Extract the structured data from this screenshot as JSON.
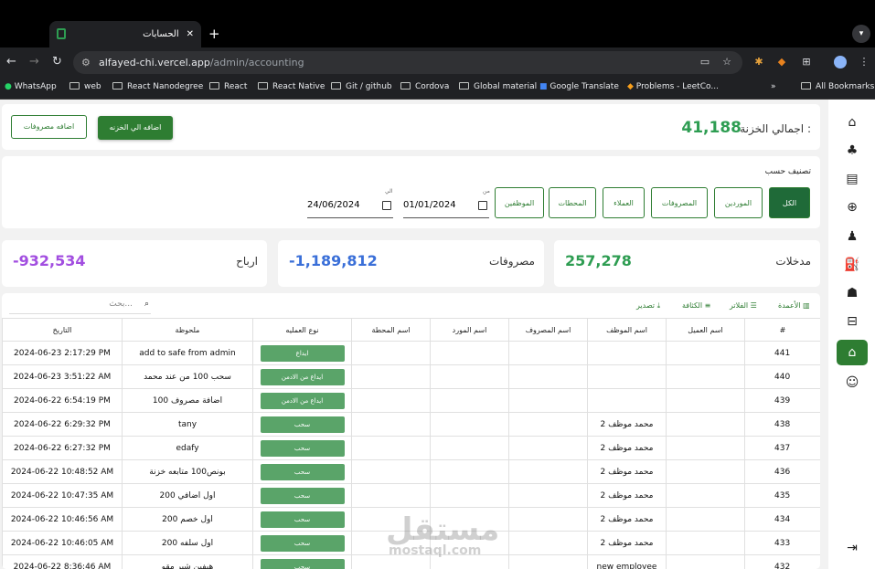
{
  "browser": {
    "tab_title": "الحسابات",
    "url_host": "alfayed-chi.vercel.app",
    "url_path": "/admin/accounting",
    "bookmarks": [
      "WhatsApp",
      "web",
      "React Nanodegree",
      "React",
      "React Native",
      "Git / github",
      "Cordova",
      "Global material",
      "Google Translate",
      "Problems - LeetCo...",
      "All Bookmarks"
    ]
  },
  "header": {
    "total_label": "اجمالي الخزنة :",
    "total_value": "41,188",
    "add_safe_button": "اضافه الي الخزنه",
    "add_expense_button": "اضافه مصروفات"
  },
  "filter": {
    "title": "تصنيف حسب",
    "buttons": [
      "الكل",
      "الموردين",
      "المصروفات",
      "العملاء",
      "المحطات",
      "الموظفين"
    ],
    "from_label": "من",
    "to_label": "الي",
    "from_date": "01/01/2024",
    "to_date": "24/06/2024"
  },
  "stats": {
    "income_label": "مدخلات",
    "income_value": "257,278",
    "expenses_label": "مصروفات",
    "expenses_value": "-1,189,812",
    "profit_label": "ارباح",
    "profit_value": "-932,534"
  },
  "toolbar": {
    "columns": "الأعمدة",
    "filters": "الفلاتر",
    "density": "الكثافة",
    "export": "تصدير",
    "search_placeholder": "بحث..."
  },
  "table": {
    "headers": [
      "#",
      "اسم العميل",
      "اسم الموظف",
      "اسم المصروف",
      "اسم المورد",
      "اسم المحطة",
      "نوع العمليه",
      "ملحوظة",
      "التاريخ"
    ],
    "rows": [
      [
        "441",
        "",
        "",
        "",
        "",
        "",
        "ايداع",
        "add to safe from admin",
        "2024-06-23 2:17:29 PM"
      ],
      [
        "440",
        "",
        "",
        "",
        "",
        "",
        "ايداع من الادمن",
        "سحب 100 من عند محمد",
        "2024-06-23 3:51:22 AM"
      ],
      [
        "439",
        "",
        "",
        "",
        "",
        "",
        "ايداع من الادمن",
        "اضافة مصروف 100",
        "2024-06-22 6:54:19 PM"
      ],
      [
        "438",
        "",
        "محمد موظف 2",
        "",
        "",
        "",
        "سحب",
        "tany",
        "2024-06-22 6:29:32 PM"
      ],
      [
        "437",
        "",
        "محمد موظف 2",
        "",
        "",
        "",
        "سحب",
        "edafy",
        "2024-06-22 6:27:32 PM"
      ],
      [
        "436",
        "",
        "محمد موظف 2",
        "",
        "",
        "",
        "سحب",
        "بونص100 متابعه خزنة",
        "2024-06-22 10:48:52 AM"
      ],
      [
        "435",
        "",
        "محمد موظف 2",
        "",
        "",
        "",
        "سحب",
        "اول اضافي 200",
        "2024-06-22 10:47:35 AM"
      ],
      [
        "434",
        "",
        "محمد موظف 2",
        "",
        "",
        "",
        "سحب",
        "اول خصم 200",
        "2024-06-22 10:46:56 AM"
      ],
      [
        "433",
        "",
        "محمد موظف 2",
        "",
        "",
        "",
        "سحب",
        "اول سلفه 200",
        "2024-06-22 10:46:05 AM"
      ],
      [
        "432",
        "",
        "new employee",
        "",
        "",
        "",
        "سحب",
        "هيفين شير مقو",
        "2024-06-22 8:36:46 AM"
      ]
    ]
  },
  "watermark": {
    "ar": "مستقل",
    "en": "mostaql.com"
  }
}
